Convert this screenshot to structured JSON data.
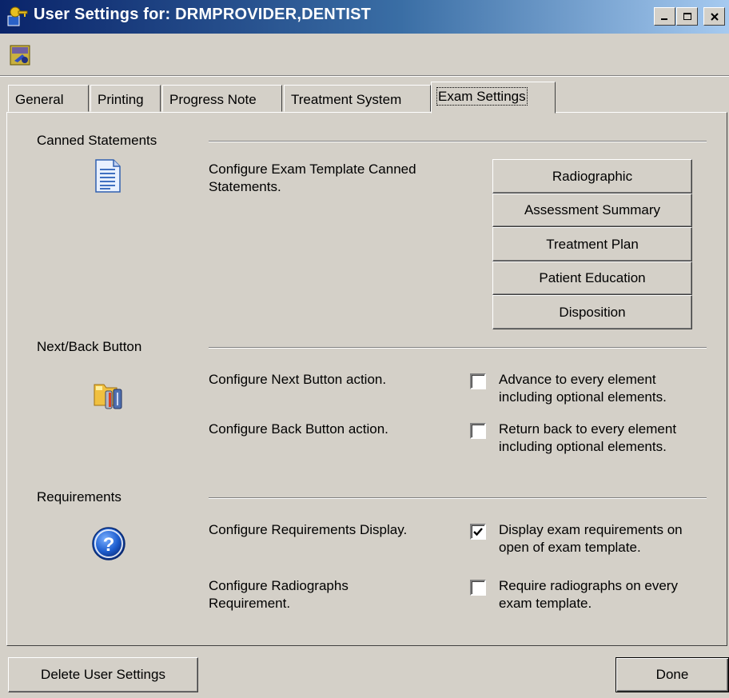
{
  "window": {
    "title": "User Settings for: DRMPROVIDER,DENTIST"
  },
  "tabs": [
    {
      "label": "General"
    },
    {
      "label": "Printing"
    },
    {
      "label": "Progress Note"
    },
    {
      "label": "Treatment System"
    },
    {
      "label": "Exam Settings"
    }
  ],
  "canned": {
    "title": "Canned Statements",
    "description": "Configure Exam Template Canned Statements.",
    "icon": "document-icon",
    "buttons": [
      {
        "label": "Radiographic"
      },
      {
        "label": "Assessment Summary"
      },
      {
        "label": "Treatment Plan"
      },
      {
        "label": "Patient Education"
      },
      {
        "label": "Disposition"
      }
    ]
  },
  "nextback": {
    "title": "Next/Back Button",
    "icon": "folder-settings-icon",
    "next_desc": "Configure Next Button action.",
    "next_option": "Advance to every element including optional elements.",
    "next_checked": false,
    "back_desc": "Configure Back Button action.",
    "back_option": "Return back to every element including optional elements.",
    "back_checked": false
  },
  "requirements": {
    "title": "Requirements",
    "icon": "help-icon",
    "display_desc": "Configure Requirements Display.",
    "display_option": "Display exam requirements on open of exam template.",
    "display_checked": true,
    "radio_desc": "Configure Radiographs Requirement.",
    "radio_option": "Require radiographs on every exam template.",
    "radio_checked": false
  },
  "footer": {
    "delete_label": "Delete User Settings",
    "done_label": "Done"
  },
  "colors": {
    "titlebar_start": "#0a246a",
    "titlebar_end": "#a6caf0",
    "face": "#d4d0c8"
  }
}
